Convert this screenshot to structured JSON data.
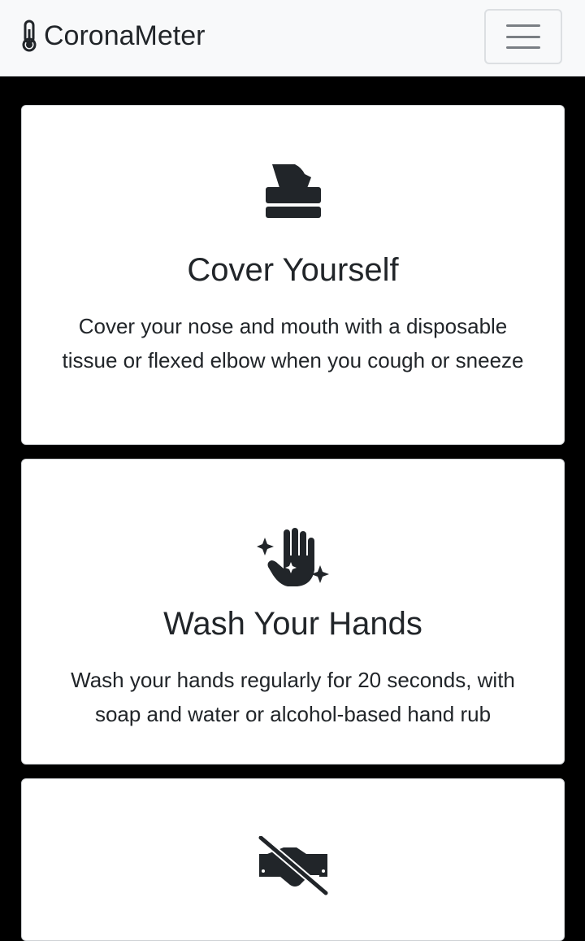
{
  "navbar": {
    "brand": "CoronaMeter",
    "brand_icon": "thermometer-icon",
    "toggle_icon": "hamburger-menu-icon"
  },
  "cards": [
    {
      "icon": "tissue-box-icon",
      "title": "Cover Yourself",
      "text": "Cover your nose and mouth with a disposable tissue or flexed elbow when you cough or sneeze"
    },
    {
      "icon": "sparkling-clean-hand-icon",
      "title": "Wash Your Hands",
      "text": "Wash your hands regularly for 20 seconds, with soap and water or alcohol-based hand rub"
    },
    {
      "icon": "no-handshake-icon",
      "title": "",
      "text": ""
    }
  ],
  "colors": {
    "navbar_bg": "#f8f9fa",
    "page_bg": "#000000",
    "card_bg": "#ffffff",
    "text": "#212529"
  }
}
